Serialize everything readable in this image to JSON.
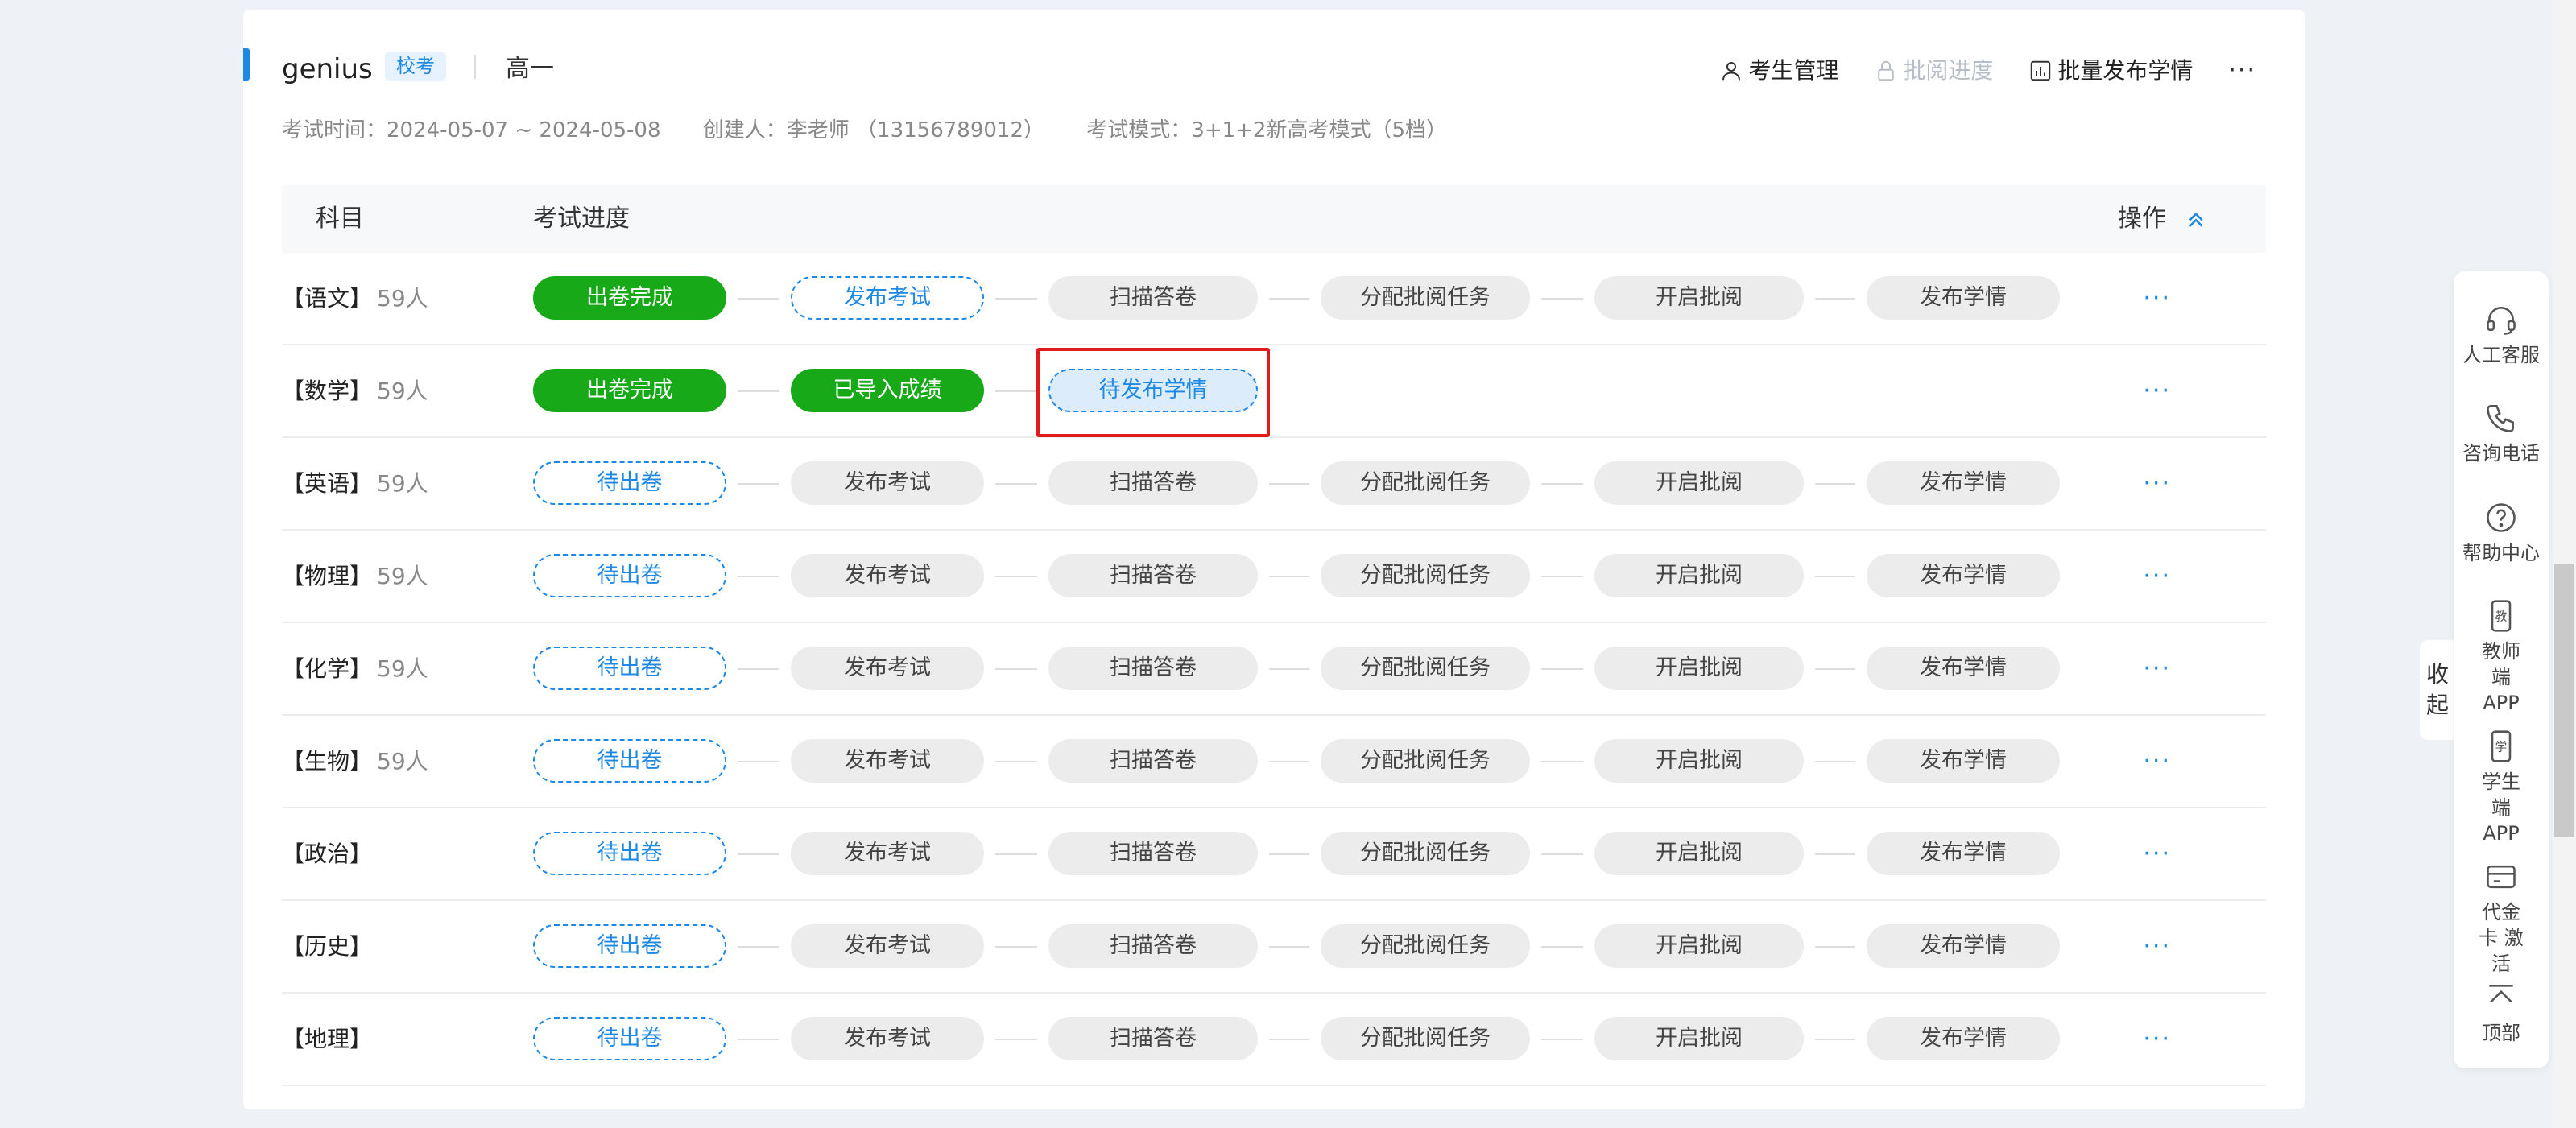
{
  "header": {
    "exam_name": "genius",
    "tag": "校考",
    "grade": "高一",
    "actions": [
      {
        "label": "考生管理",
        "icon": "user-icon",
        "enabled": true
      },
      {
        "label": "批阅进度",
        "icon": "lock-icon",
        "enabled": false
      },
      {
        "label": "批量发布学情",
        "icon": "bar-chart-icon",
        "enabled": true
      }
    ],
    "more": "···"
  },
  "meta": {
    "time": "考试时间：2024-05-07 ~ 2024-05-08",
    "creator": "创建人：李老师 （13156789012）",
    "mode": "考试模式：3+1+2新高考模式（5档）"
  },
  "table": {
    "headers": {
      "subject": "科目",
      "progress": "考试进度",
      "operation": "操作"
    },
    "rows": [
      {
        "subject": "【语文】",
        "count": "59人",
        "steps": [
          {
            "label": "出卷完成",
            "state": "done"
          },
          {
            "label": "发布考试",
            "state": "current"
          },
          {
            "label": "扫描答卷",
            "state": "pending"
          },
          {
            "label": "分配批阅任务",
            "state": "pending"
          },
          {
            "label": "开启批阅",
            "state": "pending"
          },
          {
            "label": "发布学情",
            "state": "pending"
          }
        ],
        "more": "···"
      },
      {
        "subject": "【数学】",
        "count": "59人",
        "steps": [
          {
            "label": "出卷完成",
            "state": "done"
          },
          {
            "label": "已导入成绩",
            "state": "done"
          },
          {
            "label": "待发布学情",
            "state": "current-filled"
          }
        ],
        "more": "···"
      },
      {
        "subject": "【英语】",
        "count": "59人",
        "steps": [
          {
            "label": "待出卷",
            "state": "current"
          },
          {
            "label": "发布考试",
            "state": "pending"
          },
          {
            "label": "扫描答卷",
            "state": "pending"
          },
          {
            "label": "分配批阅任务",
            "state": "pending"
          },
          {
            "label": "开启批阅",
            "state": "pending"
          },
          {
            "label": "发布学情",
            "state": "pending"
          }
        ],
        "more": "···"
      },
      {
        "subject": "【物理】",
        "count": "59人",
        "steps": [
          {
            "label": "待出卷",
            "state": "current"
          },
          {
            "label": "发布考试",
            "state": "pending"
          },
          {
            "label": "扫描答卷",
            "state": "pending"
          },
          {
            "label": "分配批阅任务",
            "state": "pending"
          },
          {
            "label": "开启批阅",
            "state": "pending"
          },
          {
            "label": "发布学情",
            "state": "pending"
          }
        ],
        "more": "···"
      },
      {
        "subject": "【化学】",
        "count": "59人",
        "steps": [
          {
            "label": "待出卷",
            "state": "current"
          },
          {
            "label": "发布考试",
            "state": "pending"
          },
          {
            "label": "扫描答卷",
            "state": "pending"
          },
          {
            "label": "分配批阅任务",
            "state": "pending"
          },
          {
            "label": "开启批阅",
            "state": "pending"
          },
          {
            "label": "发布学情",
            "state": "pending"
          }
        ],
        "more": "···"
      },
      {
        "subject": "【生物】",
        "count": "59人",
        "steps": [
          {
            "label": "待出卷",
            "state": "current"
          },
          {
            "label": "发布考试",
            "state": "pending"
          },
          {
            "label": "扫描答卷",
            "state": "pending"
          },
          {
            "label": "分配批阅任务",
            "state": "pending"
          },
          {
            "label": "开启批阅",
            "state": "pending"
          },
          {
            "label": "发布学情",
            "state": "pending"
          }
        ],
        "more": "···"
      },
      {
        "subject": "【政治】",
        "count": "",
        "steps": [
          {
            "label": "待出卷",
            "state": "current"
          },
          {
            "label": "发布考试",
            "state": "pending"
          },
          {
            "label": "扫描答卷",
            "state": "pending"
          },
          {
            "label": "分配批阅任务",
            "state": "pending"
          },
          {
            "label": "开启批阅",
            "state": "pending"
          },
          {
            "label": "发布学情",
            "state": "pending"
          }
        ],
        "more": "···"
      },
      {
        "subject": "【历史】",
        "count": "",
        "steps": [
          {
            "label": "待出卷",
            "state": "current"
          },
          {
            "label": "发布考试",
            "state": "pending"
          },
          {
            "label": "扫描答卷",
            "state": "pending"
          },
          {
            "label": "分配批阅任务",
            "state": "pending"
          },
          {
            "label": "开启批阅",
            "state": "pending"
          },
          {
            "label": "发布学情",
            "state": "pending"
          }
        ],
        "more": "···"
      },
      {
        "subject": "【地理】",
        "count": "",
        "steps": [
          {
            "label": "待出卷",
            "state": "current"
          },
          {
            "label": "发布考试",
            "state": "pending"
          },
          {
            "label": "扫描答卷",
            "state": "pending"
          },
          {
            "label": "分配批阅任务",
            "state": "pending"
          },
          {
            "label": "开启批阅",
            "state": "pending"
          },
          {
            "label": "发布学情",
            "state": "pending"
          }
        ],
        "more": "···"
      }
    ]
  },
  "side_panel": {
    "items": [
      {
        "label": "人工客服",
        "icon": "headset-icon"
      },
      {
        "label": "咨询电话",
        "icon": "phone-icon"
      },
      {
        "label": "帮助中心",
        "icon": "help-icon"
      },
      {
        "label": "教师端 APP",
        "icon": "teacher-app-icon",
        "glyph": "教"
      },
      {
        "label": "学生端 APP",
        "icon": "student-app-icon",
        "glyph": "学"
      },
      {
        "label": "代金卡 激活",
        "icon": "card-icon"
      },
      {
        "label": "顶部",
        "icon": "back-to-top-icon"
      }
    ],
    "collapse_label": "收起"
  },
  "colors": {
    "accent": "#1e88e5",
    "done": "#18a918",
    "highlight": "#e01b1b"
  }
}
